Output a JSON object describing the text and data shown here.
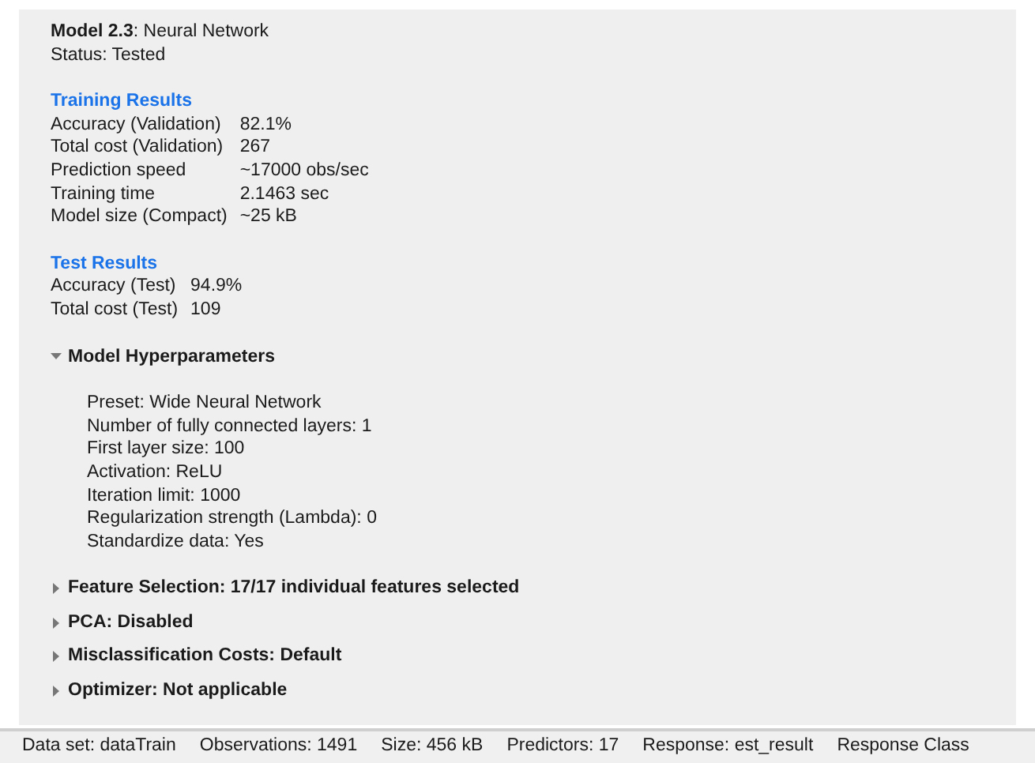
{
  "model": {
    "title": "**Model 2.3**: Neural Network",
    "status": "Status: Tested"
  },
  "result_groups": [
    {
      "heading": "Training Results",
      "rows": [
        {
          "label": "Accuracy (Validation)",
          "value": "82.1%"
        },
        {
          "label": "Total cost (Validation)",
          "value": "267"
        },
        {
          "label": "Prediction speed",
          "value": "~17000 obs/sec"
        },
        {
          "label": "Training time",
          "value": "2.1463 sec"
        },
        {
          "label": "Model size (Compact)",
          "value": "~25 kB"
        }
      ]
    },
    {
      "heading": "Test Results",
      "rows": [
        {
          "label": "Accuracy (Test)",
          "value": "94.9%"
        },
        {
          "label": "Total cost (Test)",
          "value": "109"
        }
      ]
    }
  ],
  "sections": [
    {
      "title": "Model Hyperparameters",
      "expanded": true,
      "items": [
        "Preset: Wide Neural Network",
        "Number of fully connected layers: 1",
        "First layer size: 100",
        "Activation: ReLU",
        "Iteration limit: 1000",
        "Regularization strength (Lambda): 0",
        "Standardize data: Yes"
      ]
    },
    {
      "title": "Feature Selection: 17/17 individual features selected",
      "expanded": false
    },
    {
      "title": "PCA: Disabled",
      "expanded": false
    },
    {
      "title": "Misclassification Costs: Default",
      "expanded": false
    },
    {
      "title": "Optimizer: Not applicable",
      "expanded": false
    }
  ],
  "status_bar": [
    "Data set: dataTrain",
    "Observations: 1491",
    "Size: 456 kB",
    "Predictors: 17",
    "Response: est_result",
    "Response Class"
  ]
}
